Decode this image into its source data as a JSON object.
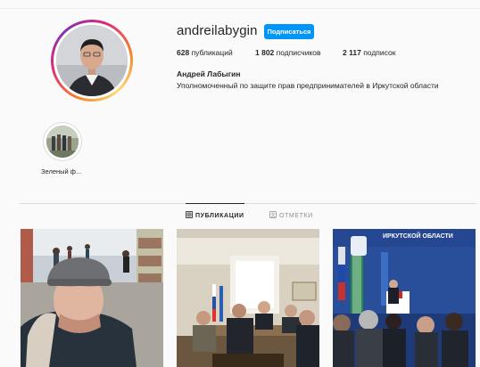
{
  "profile": {
    "username": "andreilabygin",
    "follow_label": "Подписаться",
    "stats": {
      "posts_count": "628",
      "posts_label": "публикаций",
      "followers_count": "1 802",
      "followers_label": "подписчиков",
      "following_count": "2 117",
      "following_label": "подписок"
    },
    "full_name": "Андрей Лабыгин",
    "bio": "Уполномоченный по защите прав предпринимателей в Иркутской области"
  },
  "highlights": [
    {
      "label": "Зеленый ф..."
    }
  ],
  "tabs": [
    {
      "label": "ПУБЛИКАЦИИ",
      "icon": "grid-icon",
      "active": true
    },
    {
      "label": "ОТМЕТКИ",
      "icon": "tag-icon",
      "active": false
    }
  ],
  "posts": [
    {
      "name": "selfie-street"
    },
    {
      "name": "meeting-room"
    },
    {
      "name": "conference-hall",
      "banner_text": "ИРКУТСКОЙ ОБЛАСТИ"
    }
  ],
  "colors": {
    "accent": "#0095f6",
    "background": "#fafafa",
    "text": "#262626",
    "muted": "#8e8e8e"
  }
}
